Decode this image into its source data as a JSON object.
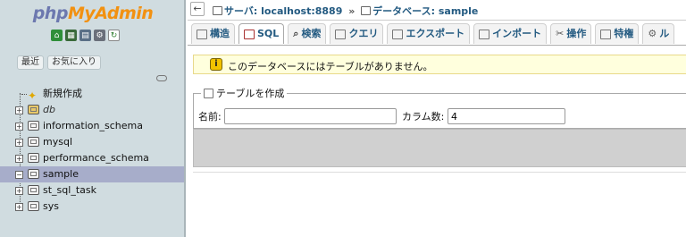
{
  "nav": {
    "logo": {
      "part1": "php",
      "part2": "My",
      "part3": "Admin"
    },
    "icons": [
      "home-icon",
      "database-icon",
      "sql-icon",
      "settings-icon",
      "reload-icon"
    ],
    "tabs": {
      "recent": "最近",
      "favorites": "お気に入り"
    },
    "tree": [
      {
        "label": "新規作成",
        "type": "new"
      },
      {
        "label": "db",
        "type": "db-italic"
      },
      {
        "label": "information_schema",
        "type": "db"
      },
      {
        "label": "mysql",
        "type": "db"
      },
      {
        "label": "performance_schema",
        "type": "db"
      },
      {
        "label": "sample",
        "type": "db",
        "active": true
      },
      {
        "label": "st_sql_task",
        "type": "db"
      },
      {
        "label": "sys",
        "type": "db"
      }
    ]
  },
  "breadcrumb": {
    "server": "サーバ: localhost:8889",
    "separator": "»",
    "database": "データベース: sample"
  },
  "tabs": [
    {
      "label": "構造",
      "icon": "structure-icon"
    },
    {
      "label": "SQL",
      "icon": "sql-icon",
      "active": true
    },
    {
      "label": "検索",
      "icon": "search-icon"
    },
    {
      "label": "クエリ",
      "icon": "query-icon"
    },
    {
      "label": "エクスポート",
      "icon": "export-icon"
    },
    {
      "label": "インポート",
      "icon": "import-icon"
    },
    {
      "label": "操作",
      "icon": "operations-icon"
    },
    {
      "label": "特権",
      "icon": "privileges-icon"
    },
    {
      "label": "ル",
      "icon": "routines-icon"
    }
  ],
  "notice": {
    "text": "このデータベースにはテーブルがありません。"
  },
  "create_table": {
    "legend": "テーブルを作成",
    "name_label": "名前:",
    "name_value": "",
    "columns_label": "カラム数:",
    "columns_value": "4"
  },
  "colors": {
    "nav_bg": "#d0dce0",
    "active_row": "#a7adca",
    "link": "#235a81",
    "notice_bg": "#ffffdd"
  }
}
